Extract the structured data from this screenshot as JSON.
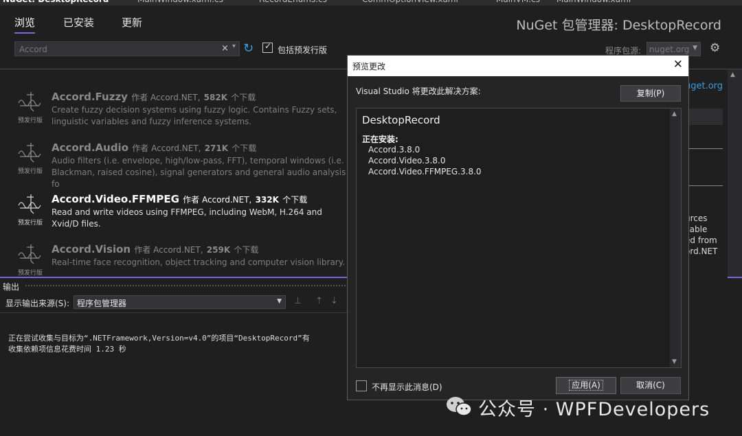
{
  "doc_tabs": [
    "NuGet: DesktopRecord",
    "MainWindow.xaml.cs",
    "RecordEnums.cs",
    "CommOptionView.xaml",
    "MainVM.cs",
    "MainWindow.xaml"
  ],
  "nuget": {
    "tabs": [
      "浏览",
      "已安装",
      "更新"
    ],
    "active_tab": "浏览",
    "title": "NuGet 包管理器: DesktopRecord",
    "search_value": "Accord",
    "clear_glyph": "×",
    "include_prerelease_label": "包括预发行版",
    "include_prerelease_checked": "✓",
    "source_label": "程序包源:",
    "source_value": "nuget.org"
  },
  "packages": [
    {
      "name": "Accord.Fuzzy",
      "by": "作者 Accord.NET,",
      "downloads": "582K",
      "downloads_suffix": "个下载",
      "description": "Create fuzzy decision systems using fuzzy logic. Contains Fuzzy sets, linguistic variables and fuzzy inference systems.",
      "prerelease": "预发行版"
    },
    {
      "name": "Accord.Audio",
      "by": "作者 Accord.NET,",
      "downloads": "271K",
      "downloads_suffix": "个下载",
      "description": "Audio filters (i.e. envelope, high/low-pass, FFT), temporal windows (i.e. Blackman, raised cosine), signal generators and general audio analysis fo",
      "prerelease": "预发行版"
    },
    {
      "name": "Accord.Video.FFMPEG",
      "by": "作者 Accord.NET,",
      "downloads": "332K",
      "downloads_suffix": "个下载",
      "description": "Read and write videos using FFMPEG, including WebM, H.264 and Xvid/D files.",
      "prerelease": "预发行版",
      "selected": true
    },
    {
      "name": "Accord.Vision",
      "by": "作者 Accord.NET,",
      "downloads": "259K",
      "downloads_suffix": "个下载",
      "description": "Real-time face recognition, object tracking and computer vision library.",
      "prerelease": "预发行版"
    }
  ],
  "right_panel": {
    "link": "uget.org",
    "text_lines": [
      "urces",
      "ilable",
      "ed from",
      "ord.NET"
    ]
  },
  "output": {
    "title": "输出",
    "source_label": "显示输出来源(S):",
    "source_value": "程序包管理器",
    "lines": [
      "正在尝试收集与目标为“.NETFramework,Version=v4.0”的项目“DesktopRecord”有",
      "收集依赖项信息花费时间 1.23 秒"
    ]
  },
  "dialog": {
    "title": "预览更改",
    "close_glyph": "✕",
    "message": "Visual Studio 将更改此解决方案:",
    "copy_button": "复制(P)",
    "project_name": "DesktopRecord",
    "installing_label": "正在安装:",
    "installing": [
      "Accord.3.8.0",
      "Accord.Video.3.8.0",
      "Accord.Video.FFMPEG.3.8.0"
    ],
    "dont_show_label": "不再显示此消息(D)",
    "apply_button": "应用(A)",
    "cancel_button": "取消(C)"
  },
  "watermark": {
    "text": "公众号 · WPFDevelopers"
  },
  "colors": {
    "accent": "#7a66d9",
    "link": "#3c9ce0",
    "background": "#1f1f1f"
  }
}
